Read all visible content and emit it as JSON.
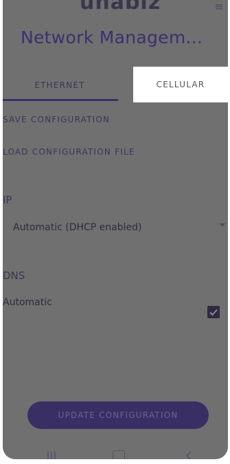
{
  "app": {
    "logo_text": "unabiz",
    "title": "Network Managem..."
  },
  "tabs": [
    {
      "label": "ETHERNET",
      "selected": true
    },
    {
      "label": "CELLULAR",
      "selected": false
    }
  ],
  "actions": {
    "save_configuration": "SAVE CONFIGURATION",
    "load_configuration_file": "LOAD CONFIGURATION FILE"
  },
  "ip": {
    "label": "IP",
    "mode_selected": "Automatic (DHCP enabled)"
  },
  "dns": {
    "label": "DNS",
    "automatic_label": "Automatic",
    "automatic_checked": true
  },
  "update_button_label": "UPDATE CONFIGURATION",
  "colors": {
    "primary": "#3d2d6b",
    "overlay": "#707070",
    "title": "#3d2f6e"
  },
  "icons": {
    "overflow_menu": "more-icon",
    "dropdown": "caret-down-icon",
    "checkbox": "check-icon",
    "nav_recents": "recents-icon",
    "nav_home": "home-icon",
    "nav_back": "back-icon"
  }
}
